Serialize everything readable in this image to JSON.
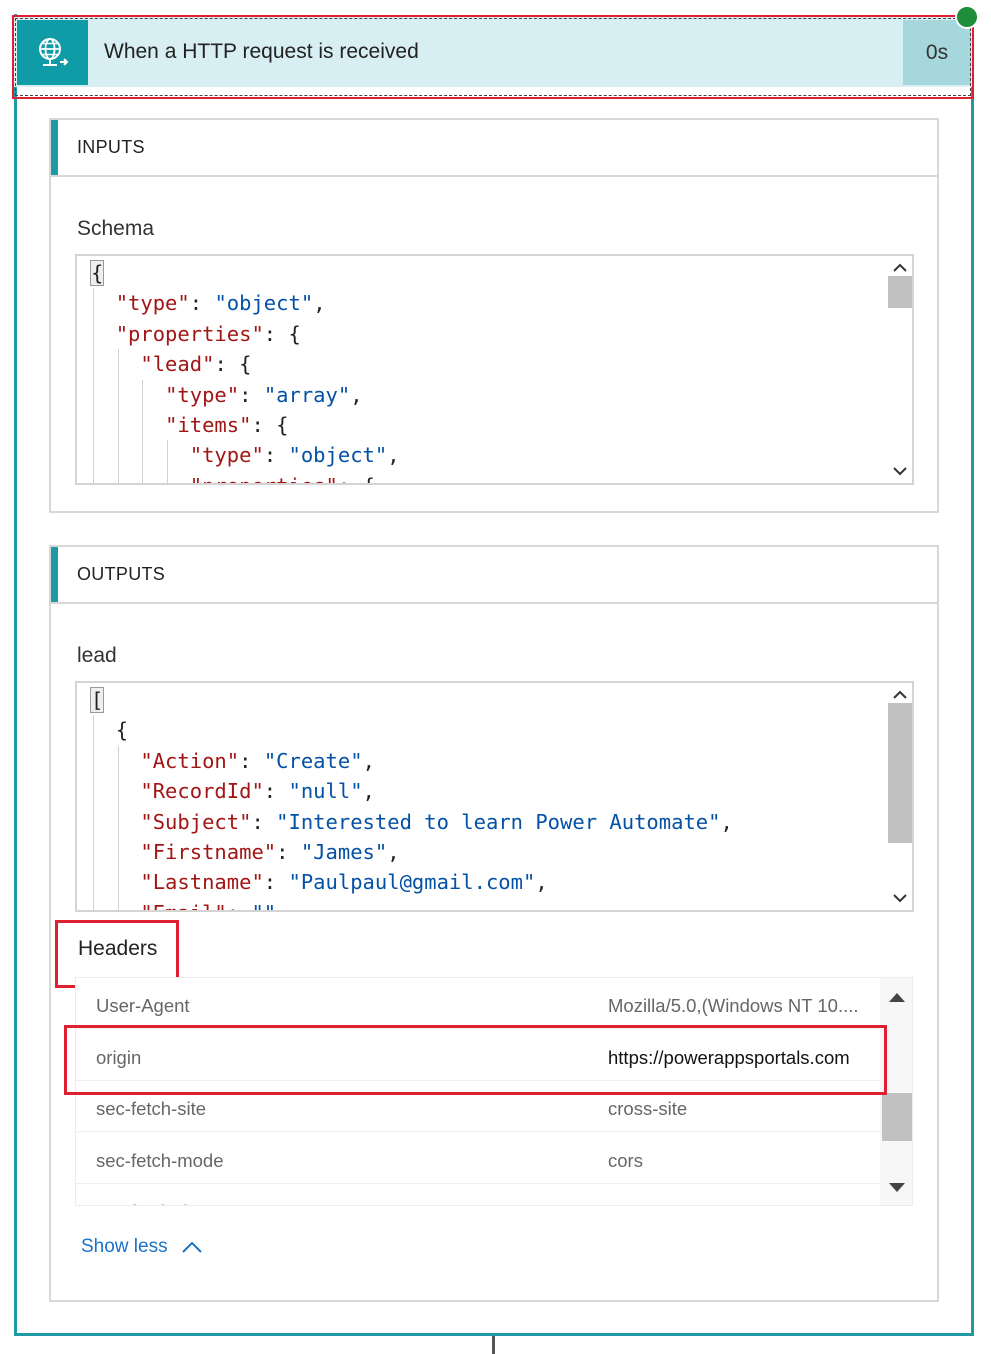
{
  "trigger": {
    "title": "When a HTTP request is received",
    "duration": "0s",
    "icon": "globe-request-icon",
    "status": "succeeded"
  },
  "inputs": {
    "section_title": "INPUTS",
    "schema_label": "Schema",
    "schema_lines": [
      [
        {
          "t": "p",
          "v": "{"
        }
      ],
      [
        {
          "t": "k",
          "v": "\"type\""
        },
        {
          "t": "p",
          "v": ": "
        },
        {
          "t": "s",
          "v": "\"object\""
        },
        {
          "t": "p",
          "v": ","
        }
      ],
      [
        {
          "t": "k",
          "v": "\"properties\""
        },
        {
          "t": "p",
          "v": ": {"
        }
      ],
      [
        {
          "t": "k",
          "v": "\"lead\""
        },
        {
          "t": "p",
          "v": ": {"
        }
      ],
      [
        {
          "t": "k",
          "v": "\"type\""
        },
        {
          "t": "p",
          "v": ": "
        },
        {
          "t": "s",
          "v": "\"array\""
        },
        {
          "t": "p",
          "v": ","
        }
      ],
      [
        {
          "t": "k",
          "v": "\"items\""
        },
        {
          "t": "p",
          "v": ": {"
        }
      ],
      [
        {
          "t": "k",
          "v": "\"type\""
        },
        {
          "t": "p",
          "v": ": "
        },
        {
          "t": "s",
          "v": "\"object\""
        },
        {
          "t": "p",
          "v": ","
        }
      ],
      [
        {
          "t": "k",
          "v": "\"properties\""
        },
        {
          "t": "p",
          "v": ": {"
        }
      ]
    ],
    "schema_indents": [
      0,
      1,
      1,
      2,
      3,
      3,
      4,
      4
    ]
  },
  "outputs": {
    "section_title": "OUTPUTS",
    "lead_label": "lead",
    "lead_lines": [
      [
        {
          "t": "p",
          "v": "["
        }
      ],
      [
        {
          "t": "p",
          "v": "{"
        }
      ],
      [
        {
          "t": "k",
          "v": "\"Action\""
        },
        {
          "t": "p",
          "v": ": "
        },
        {
          "t": "s",
          "v": "\"Create\""
        },
        {
          "t": "p",
          "v": ","
        }
      ],
      [
        {
          "t": "k",
          "v": "\"RecordId\""
        },
        {
          "t": "p",
          "v": ": "
        },
        {
          "t": "s",
          "v": "\"null\""
        },
        {
          "t": "p",
          "v": ","
        }
      ],
      [
        {
          "t": "k",
          "v": "\"Subject\""
        },
        {
          "t": "p",
          "v": ": "
        },
        {
          "t": "s",
          "v": "\"Interested to learn Power Automate\""
        },
        {
          "t": "p",
          "v": ","
        }
      ],
      [
        {
          "t": "k",
          "v": "\"Firstname\""
        },
        {
          "t": "p",
          "v": ": "
        },
        {
          "t": "s",
          "v": "\"James\""
        },
        {
          "t": "p",
          "v": ","
        }
      ],
      [
        {
          "t": "k",
          "v": "\"Lastname\""
        },
        {
          "t": "p",
          "v": ": "
        },
        {
          "t": "s",
          "v": "\"Paulpaul@gmail.com\""
        },
        {
          "t": "p",
          "v": ","
        }
      ],
      [
        {
          "t": "k",
          "v": "\"Email\""
        },
        {
          "t": "p",
          "v": ": "
        },
        {
          "t": "s",
          "v": "\"\""
        }
      ]
    ],
    "lead_indents": [
      0,
      1,
      2,
      2,
      2,
      2,
      2,
      2
    ],
    "headers_label": "Headers",
    "headers": [
      {
        "key": "User-Agent",
        "value": "Mozilla/5.0,(Windows NT 10...."
      },
      {
        "key": "origin",
        "value": "https://powerappsportals.com"
      },
      {
        "key": "sec-fetch-site",
        "value": "cross-site"
      },
      {
        "key": "sec-fetch-mode",
        "value": "cors"
      },
      {
        "key": "sec-fetch-dest",
        "value": "empty"
      }
    ],
    "highlighted_header": 1,
    "show_less_label": "Show less"
  },
  "colors": {
    "accent": "#1f9aa5",
    "json_key": "#a31515",
    "json_string": "#0451a5",
    "annotation": "#e02030",
    "link": "#1a73c9"
  }
}
